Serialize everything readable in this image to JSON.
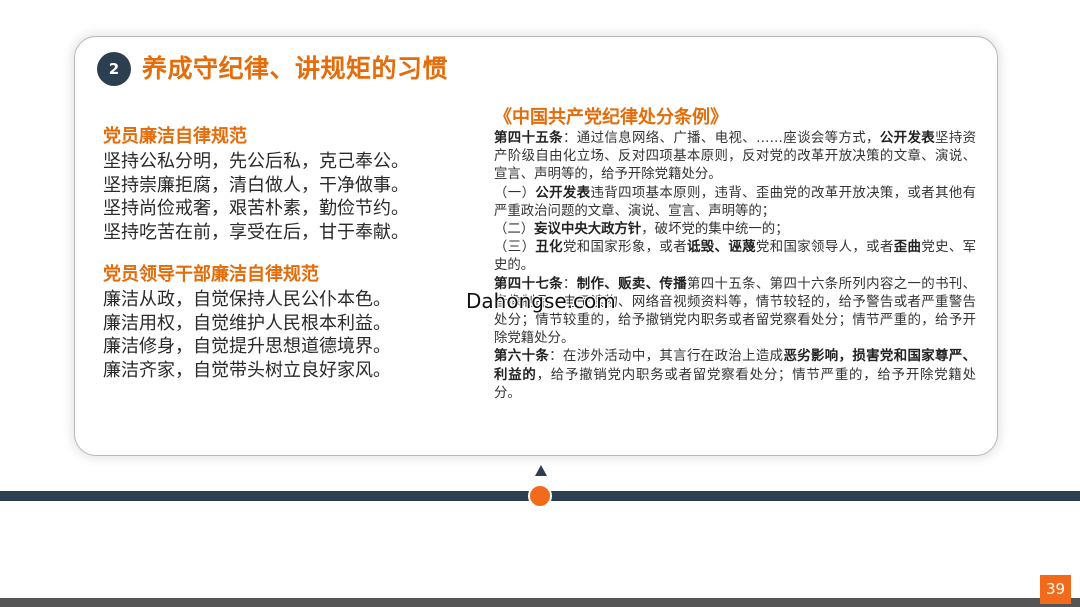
{
  "slide": {
    "number": "2",
    "title": "养成守纪律、讲规矩的习惯",
    "page_number": "39",
    "watermark": "Dahongse.com"
  },
  "colors": {
    "accent_orange": "#e46c0a",
    "dark_navy": "#2c3f50",
    "dot_orange": "#f26b1d"
  },
  "left": {
    "sections": [
      {
        "title": "党员廉洁自律规范",
        "lines": [
          "坚持公私分明，先公后私，克己奉公。",
          "坚持崇廉拒腐，清白做人，干净做事。",
          "坚持尚俭戒奢，艰苦朴素，勤俭节约。",
          "坚持吃苦在前，享受在后，甘于奉献。"
        ]
      },
      {
        "title": "党员领导干部廉洁自律规范",
        "lines": [
          "廉洁从政，自觉保持人民公仆本色。",
          "廉洁用权，自觉维护人民根本利益。",
          "廉洁修身，自觉提升思想道德境界。",
          "廉洁齐家，自觉带头树立良好家风。"
        ]
      }
    ]
  },
  "right": {
    "title": "《中国共产党纪律处分条例》",
    "p45": {
      "a": "第四十五条",
      "b": "：通过信息网络、广播、电视、……座谈会等方式，",
      "c": "公开发表",
      "d": "坚持资产阶级自由化立场、反对四项基本原则，反对党的改革开放决策的文章、演说、宣言、声明等的，给予开除党籍处分。"
    },
    "p45_1": {
      "a": "（一）",
      "b": "公开发表",
      "c": "违背四项基本原则，违背、歪曲党的改革开放决策，或者其他有严重政治问题的文章、演说、宣言、声明等的；"
    },
    "p45_2": {
      "a": "（二）",
      "b": "妄议中央大政方针",
      "c": "，破坏党的集中统一的；"
    },
    "p45_3": {
      "a": "（三）",
      "b": "丑化",
      "c": "党和国家形象，或者",
      "d": "诋毁、诬蔑",
      "e": "党和国家领导人，或者",
      "f": "歪曲",
      "g": "党史、军史的。"
    },
    "p47": {
      "a": "第四十七条",
      "b": "：",
      "c": "制作、贩卖、传播",
      "d": "第四十五条、第四十六条所列内容之一的书刊、音像制品、电子读物、网络音视频资料等，情节较轻的，给予警告或者严重警告处分；情节较重的，给予撤销党内职务或者留党察看处分；情节严重的，给予开除党籍处分。"
    },
    "p60": {
      "a": "第六十条",
      "b": "：在涉外活动中，其言行在政治上造成",
      "c": "恶劣影响，损害党和国家尊严、利益的",
      "d": "，给予撤销党内职务或者留党察看处分；情节严重的，给予开除党籍处分。"
    }
  }
}
